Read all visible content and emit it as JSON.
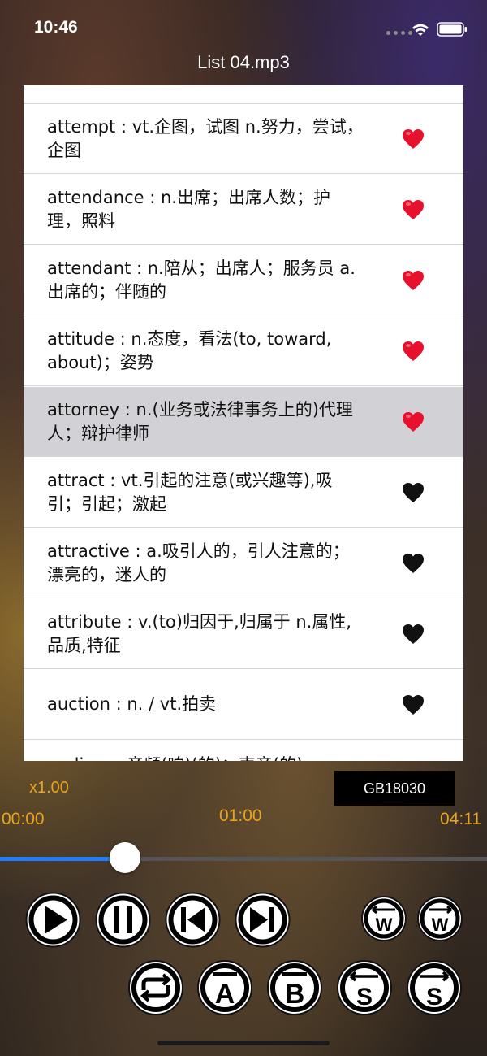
{
  "status": {
    "time": "10:46"
  },
  "nav": {
    "title": "List 04.mp3"
  },
  "list": {
    "rows": [
      {
        "text": "attempt : vt.企图，试图 n.努力，尝试，企图",
        "favorite": true
      },
      {
        "text": "attendance : n.出席；出席人数；护理，照料",
        "favorite": true
      },
      {
        "text": "attendant : n.陪从；出席人；服务员 a.出席的；伴随的",
        "favorite": true
      },
      {
        "text": "attitude : n.态度，看法(to, toward, about)；姿势",
        "favorite": true
      },
      {
        "text": "attorney : n.(业务或法律事务上的)代理人；辩护律师",
        "favorite": true,
        "selected": true
      },
      {
        "text": "attract : vt.引起的注意(或兴趣等),吸引；引起；激起",
        "favorite": false
      },
      {
        "text": "attractive : a.吸引人的，引人注意的；漂亮的，迷人的",
        "favorite": false
      },
      {
        "text": "attribute : v.(to)归因于,归属于 n.属性,品质,特征",
        "favorite": false
      },
      {
        "text": "auction : n. / vt.拍卖",
        "favorite": false
      }
    ],
    "partial_row_text": "audio : a.音频(响)(的)；声音(的)"
  },
  "player": {
    "speed": "x1.00",
    "encoding": "GB18030",
    "time_start": "00:00",
    "time_current": "01:00",
    "time_end": "04:11",
    "progress": 0.2389
  },
  "colors": {
    "accent_orange": "#e8a41a",
    "slider_blue": "#1f7cff",
    "heart_red": "#e8112d",
    "heart_black": "#111111"
  }
}
